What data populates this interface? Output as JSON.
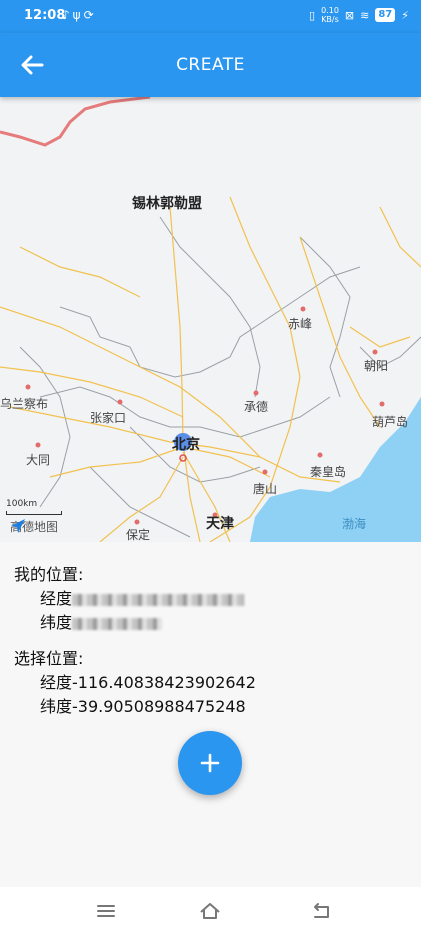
{
  "status_bar": {
    "time": "12:08",
    "left_icons": [
      "tiktok-icon",
      "usb-icon",
      "sync-icon"
    ],
    "net_speed_value": "0.10",
    "net_speed_unit": "KB/s",
    "battery": "87"
  },
  "app_bar": {
    "title": "CREATE",
    "back_icon": "arrow-left-icon"
  },
  "map": {
    "cities": [
      "锡林郭勒盟",
      "赤峰",
      "朝阳",
      "乌兰察布",
      "张家口",
      "承德",
      "葫芦岛",
      "北京",
      "大同",
      "唐山",
      "秦皇岛",
      "保定",
      "天津"
    ],
    "sea": "渤海",
    "scale": "100km",
    "logo": "高德地图"
  },
  "my_location": {
    "heading": "我的位置:",
    "longitude_label": "经度",
    "latitude_label": "纬度"
  },
  "selected_location": {
    "heading": "选择位置:",
    "longitude": "经度-116.40838423902642",
    "latitude": "纬度-39.90508988475248"
  },
  "fab": {
    "icon": "plus-icon"
  },
  "nav_bar": {
    "icons": [
      "menu-icon",
      "home-icon",
      "back-icon"
    ]
  },
  "colors": {
    "primary": "#2a96ef",
    "sea": "#8fd0f5",
    "road": "#f2c14e",
    "border": "#e57b7b"
  }
}
